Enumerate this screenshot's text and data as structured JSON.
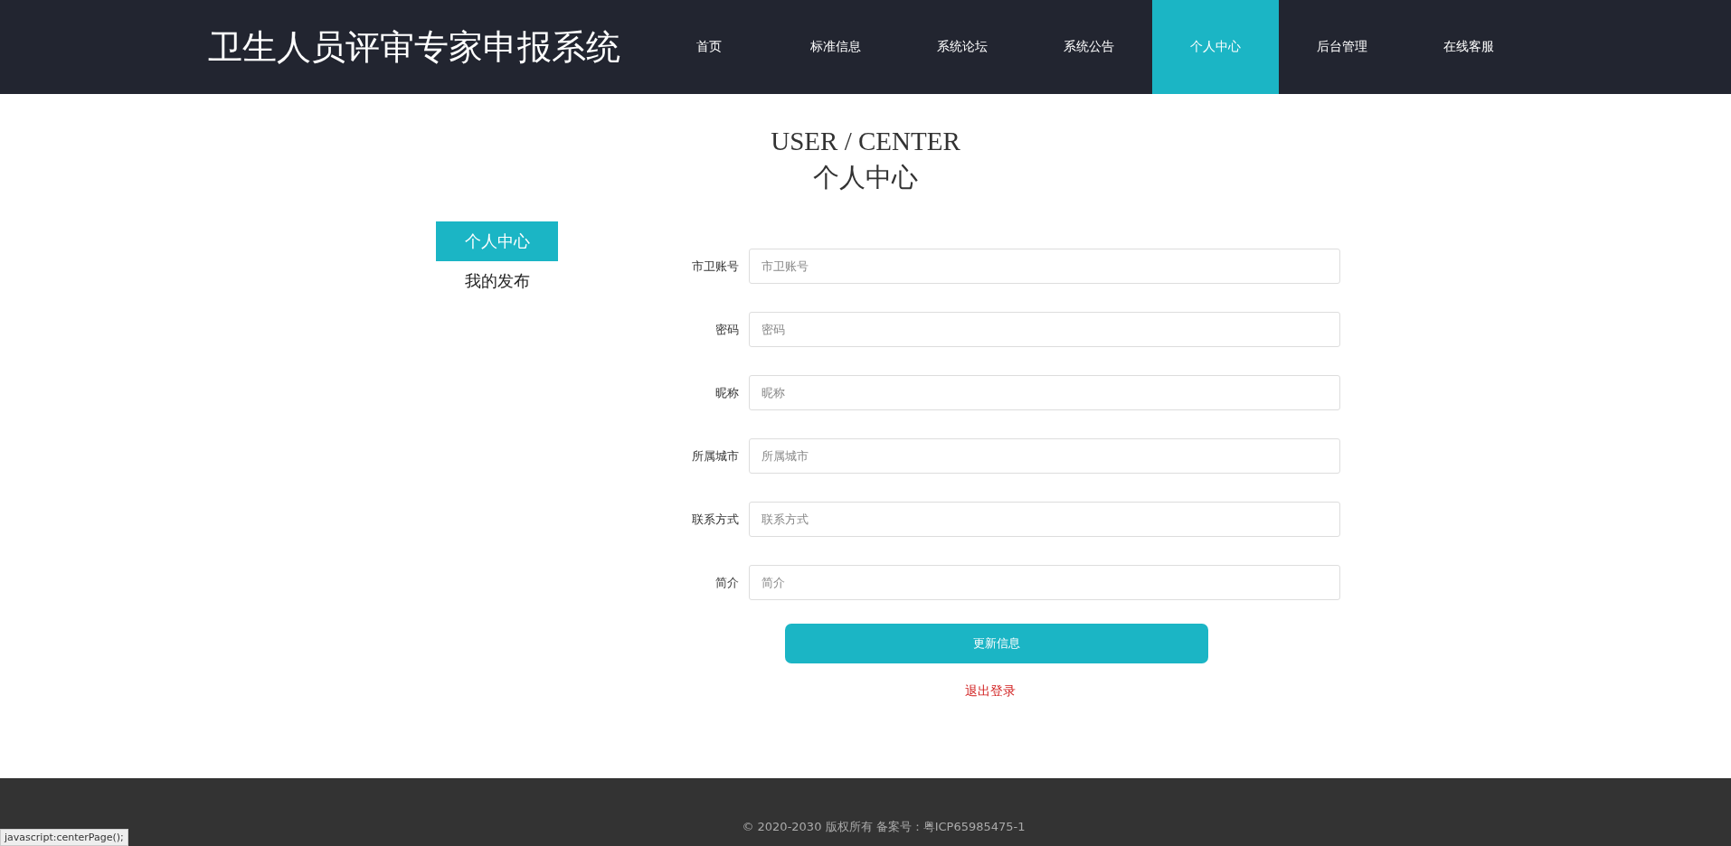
{
  "site_title": "卫生人员评审专家申报系统",
  "nav": [
    {
      "label": "首页",
      "selected": false
    },
    {
      "label": "标准信息",
      "selected": false
    },
    {
      "label": "系统论坛",
      "selected": false
    },
    {
      "label": "系统公告",
      "selected": false
    },
    {
      "label": "个人中心",
      "selected": true
    },
    {
      "label": "后台管理",
      "selected": false
    },
    {
      "label": "在线客服",
      "selected": false
    }
  ],
  "heading": {
    "english": "USER / CENTER",
    "chinese": "个人中心"
  },
  "sidebar": [
    {
      "label": "个人中心",
      "selected": true
    },
    {
      "label": "我的发布",
      "selected": false
    }
  ],
  "form": [
    {
      "label": "市卫账号",
      "placeholder": "市卫账号"
    },
    {
      "label": "密码",
      "placeholder": "密码"
    },
    {
      "label": "昵称",
      "placeholder": "昵称"
    },
    {
      "label": "所属城市",
      "placeholder": "所属城市"
    },
    {
      "label": "联系方式",
      "placeholder": "联系方式"
    },
    {
      "label": "简介",
      "placeholder": "简介"
    }
  ],
  "submit_button": "更新信息",
  "logout_link": "退出登录",
  "footer": "© 2020-2030 版权所有 备案号：粤ICP65985475-1",
  "status_bar": "javascript:centerPage();"
}
